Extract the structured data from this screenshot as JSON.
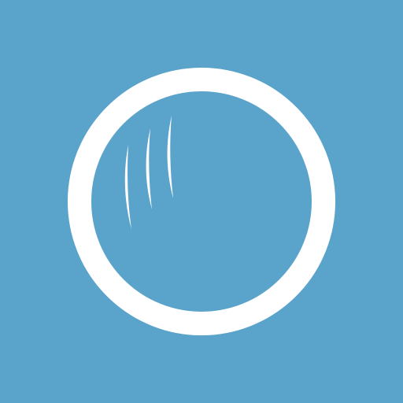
{
  "icon": {
    "name": "lens-icon",
    "colors": {
      "background": "#5aa4cc",
      "foreground": "#ffffff"
    }
  }
}
